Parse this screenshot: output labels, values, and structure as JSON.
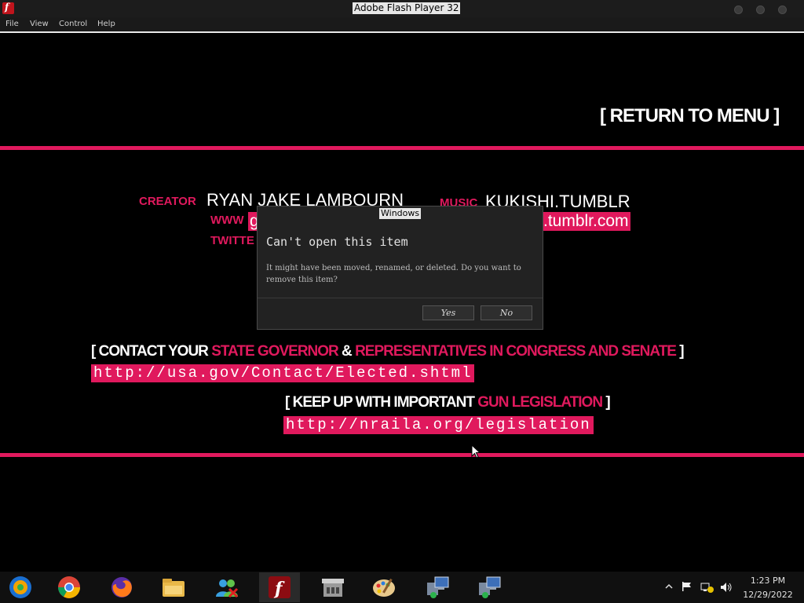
{
  "window": {
    "title": "Adobe Flash Player 32"
  },
  "menubar": {
    "items": [
      "File",
      "View",
      "Control",
      "Help"
    ]
  },
  "content": {
    "return_to_menu": "[ RETURN TO MENU ]",
    "creator_label": "CREATOR",
    "creator_name": "RYAN JAKE LAMBOURN",
    "music_label": "MUSIC",
    "music_name": "KUKISHI.TUMBLR",
    "www_label": "WWW",
    "www_partial": "g",
    "tumblr_link": ".tumblr.com",
    "twitter_label": "TWITTE",
    "contact_prefix": "[ CONTACT YOUR ",
    "contact_gov": "STATE GOVERNOR",
    "contact_amp": " & ",
    "contact_reps": "REPRESENTATIVES IN CONGRESS AND SENATE",
    "contact_suffix": " ]",
    "contact_url": "http://usa.gov/Contact/Elected.shtml",
    "keep_prefix": "[ KEEP UP WITH IMPORTANT ",
    "keep_gun": "GUN LEGISLATION",
    "keep_suffix": " ]",
    "keep_url": "http://nraila.org/legislation"
  },
  "dialog": {
    "title": "Windows",
    "heading": "Can't open this item",
    "message": "It might have been moved, renamed, or deleted. Do you want to remove this item?",
    "yes_label": "Yes",
    "no_label": "No"
  },
  "taskbar": {
    "apps": [
      "media-player-icon",
      "chrome-icon",
      "firefox-icon",
      "file-explorer-icon",
      "messenger-icon",
      "flash-player-icon",
      "store-icon",
      "paint-icon",
      "network-setup-icon",
      "network-setup-icon-2"
    ],
    "time": "1:23 PM",
    "date": "12/29/2022"
  },
  "colors": {
    "accent": "#e0195d",
    "background": "#000000"
  }
}
